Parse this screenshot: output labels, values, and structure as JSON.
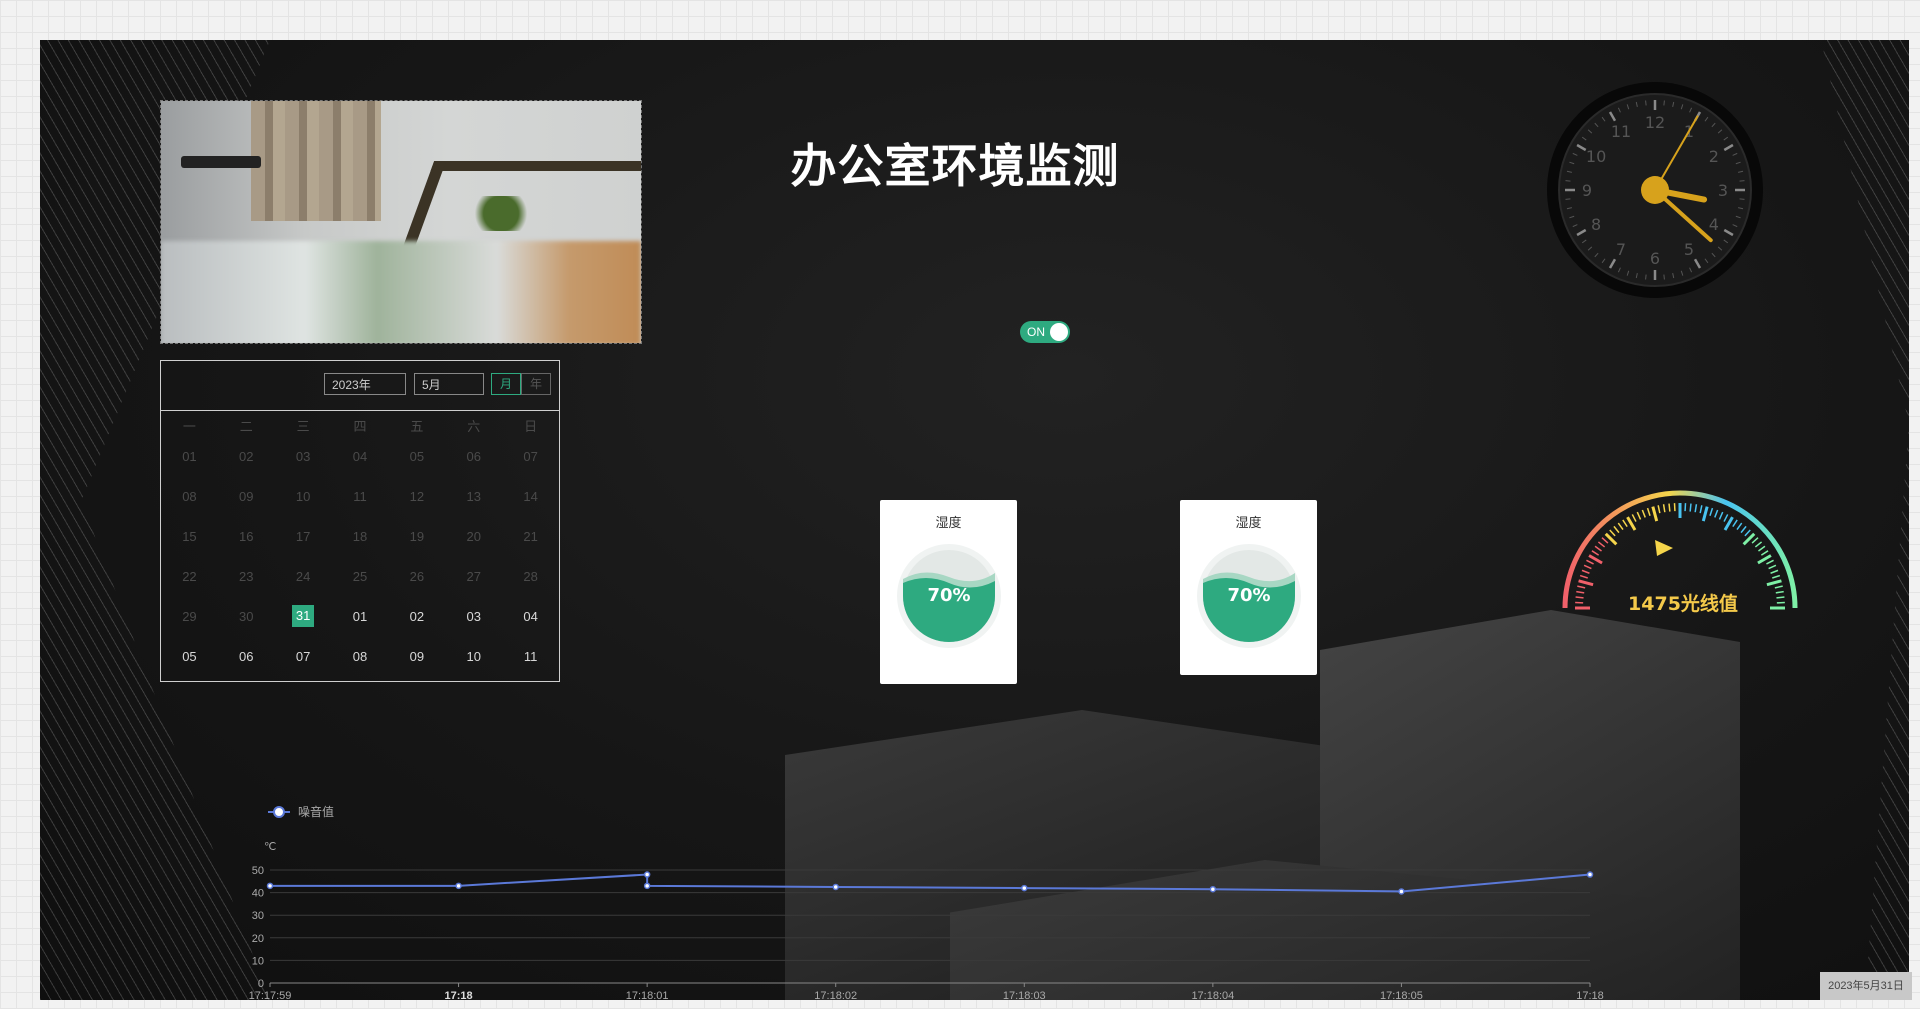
{
  "page": {
    "title": "办公室环境监测"
  },
  "toggle": {
    "label": "ON",
    "state": "on"
  },
  "clock": {
    "numbers": [
      "12",
      "1",
      "2",
      "3",
      "4",
      "5",
      "6",
      "7",
      "8",
      "9",
      "10",
      "11"
    ],
    "time": {
      "hour": 3,
      "minute": 22,
      "second": 5
    },
    "hand_color": "#d7a21c"
  },
  "calendar": {
    "year": "2023年",
    "month": "5月",
    "mode_month": "月",
    "mode_year": "年",
    "weekdays": [
      "一",
      "二",
      "三",
      "四",
      "五",
      "六",
      "日"
    ],
    "rows": [
      [
        "01",
        "02",
        "03",
        "04",
        "05",
        "06",
        "07"
      ],
      [
        "08",
        "09",
        "10",
        "11",
        "12",
        "13",
        "14"
      ],
      [
        "15",
        "16",
        "17",
        "18",
        "19",
        "20",
        "21"
      ],
      [
        "22",
        "23",
        "24",
        "25",
        "26",
        "27",
        "28"
      ],
      [
        "29",
        "30",
        "31",
        "01",
        "02",
        "03",
        "04"
      ],
      [
        "05",
        "06",
        "07",
        "08",
        "09",
        "10",
        "11"
      ]
    ],
    "today": "31",
    "accent": "#2eaa80"
  },
  "cards": [
    {
      "label": "湿度",
      "value": "70%",
      "level": 0.7
    },
    {
      "label": "湿度",
      "value": "70%",
      "level": 0.7
    }
  ],
  "gauge": {
    "value_text": "1475光线值",
    "text_color": "#f4c94a"
  },
  "chart_data": {
    "type": "line",
    "legend": "噪音值",
    "unit": "℃",
    "x": [
      "17:17:59",
      "17:18",
      "17:18:01",
      "17:18:02",
      "17:18:03",
      "17:18:04",
      "17:18:05",
      "17:18"
    ],
    "series": [
      {
        "name": "噪音值",
        "points": [
          [
            0,
            43
          ],
          [
            1,
            43
          ],
          [
            2,
            48
          ],
          [
            2,
            43
          ],
          [
            3,
            42.5
          ],
          [
            4,
            42
          ],
          [
            5,
            41.5
          ],
          [
            6,
            40.5
          ],
          [
            7,
            48
          ]
        ]
      }
    ],
    "ylim": [
      0,
      50
    ],
    "yticks": [
      0,
      10,
      20,
      30,
      40,
      50
    ],
    "line_color": "#5b79d8",
    "grid": true
  },
  "footer": {
    "timestamp": "2023年5月31日"
  }
}
